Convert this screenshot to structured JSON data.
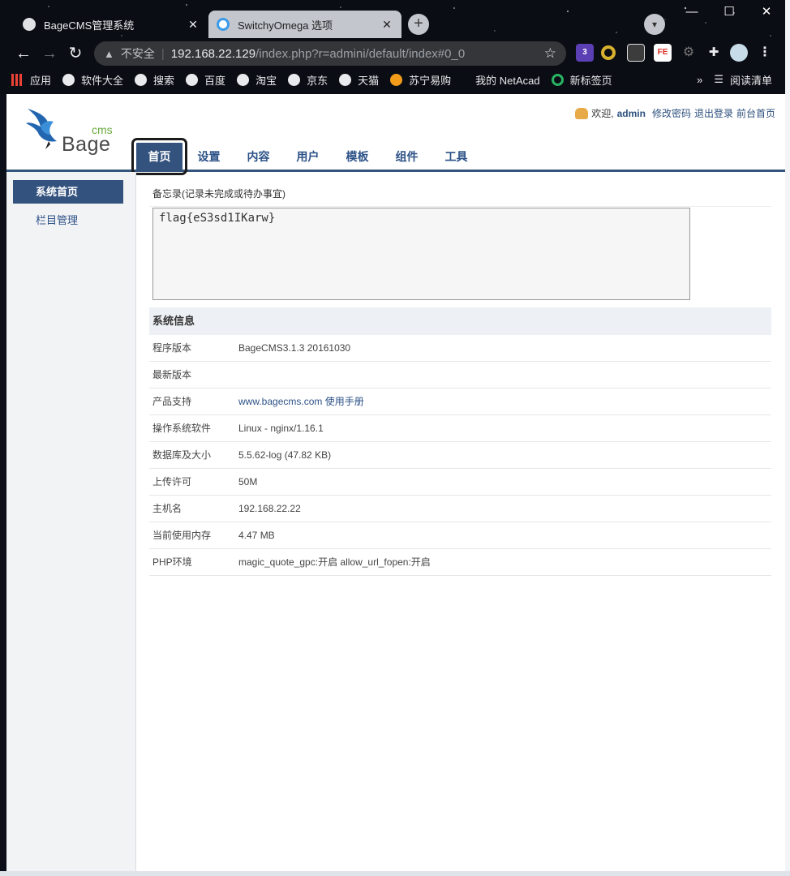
{
  "browser": {
    "tabs": [
      {
        "title": "BageCMS管理系统",
        "close": "✕"
      },
      {
        "title": "SwitchyOmega 选项",
        "close": "✕"
      }
    ],
    "new_tab": "+",
    "window_controls": {
      "minimize": "—",
      "maximize": "☐",
      "close": "✕"
    },
    "address": {
      "insecure_label": "不安全",
      "host": "192.168.22.129",
      "path": "/index.php?r=admini/default/index#0_0"
    },
    "extensions": {
      "badge_count": "3",
      "fe_label": "FE"
    },
    "bookmarks": [
      "应用",
      "软件大全",
      "搜索",
      "百度",
      "淘宝",
      "京东",
      "天猫",
      "苏宁易购",
      "我的 NetAcad",
      "新标签页"
    ],
    "bookmarks_more": "»",
    "reading_list": "阅读清单"
  },
  "header": {
    "logo_cms": "cms",
    "logo_bage": "Bage",
    "welcome": "欢迎,",
    "username": "admin",
    "links": [
      "修改密码",
      "退出登录",
      "前台首页"
    ]
  },
  "nav": {
    "tabs": [
      "首页",
      "设置",
      "内容",
      "用户",
      "模板",
      "组件",
      "工具"
    ]
  },
  "sidebar": {
    "items": [
      "系统首页",
      "栏目管理"
    ]
  },
  "memo": {
    "label": "备忘录(记录未完成或待办事宜)",
    "value": "flag{eS3sd1IKarw}"
  },
  "system_info": {
    "title": "系统信息",
    "rows": [
      {
        "key": "程序版本",
        "value": "BageCMS3.1.3 20161030"
      },
      {
        "key": "最新版本",
        "value": ""
      },
      {
        "key": "产品支持",
        "link1": "www.bagecms.com",
        "link2": "使用手册"
      },
      {
        "key": "操作系统软件",
        "value": "Linux - nginx/1.16.1"
      },
      {
        "key": "数据库及大小",
        "value": "5.5.62-log (47.82 KB)"
      },
      {
        "key": "上传许可",
        "value": "50M"
      },
      {
        "key": "主机名",
        "value": "192.168.22.22"
      },
      {
        "key": "当前使用内存",
        "value": "4.47 MB"
      },
      {
        "key": "PHP环境",
        "value": "magic_quote_gpc:开启 allow_url_fopen:开启"
      }
    ]
  }
}
